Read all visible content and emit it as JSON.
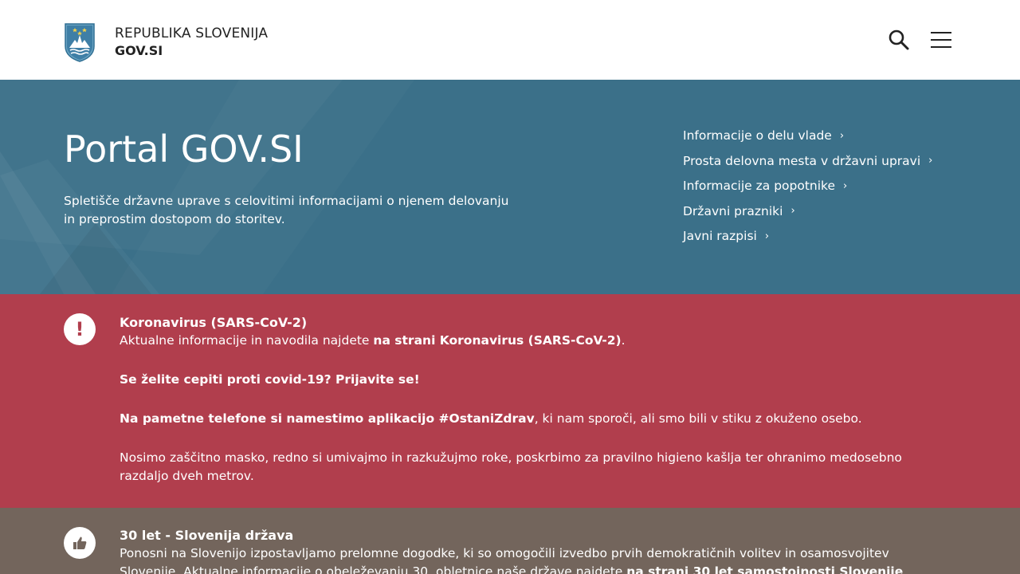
{
  "header": {
    "logo_line1": "REPUBLIKA SLOVENIJA",
    "logo_line2": "GOV.SI",
    "search_icon": "search-icon",
    "menu_icon": "hamburger-menu-icon"
  },
  "hero": {
    "title": "Portal GOV.SI",
    "description": "Spletišče državne uprave s celovitimi informacijami o njenem delovanju in preprostim dostopom do storitev.",
    "links": [
      {
        "label": "Informacije o delu vlade"
      },
      {
        "label": "Prosta delovna mesta v državni upravi"
      },
      {
        "label": "Informacije za popotnike"
      },
      {
        "label": "Državni prazniki"
      },
      {
        "label": "Javni razpisi"
      }
    ],
    "chevron": "›"
  },
  "notices": {
    "covid": {
      "icon": "!",
      "title": "Koronavirus (SARS-CoV-2)",
      "line1_prefix": "Aktualne informacije in navodila najdete ",
      "line1_link": "na strani Koronavirus (SARS-CoV-2)",
      "line1_suffix": ".",
      "vaccine": "Se želite cepiti proti covid-19? Prijavite se!",
      "app_bold": "Na pametne telefone si namestimo aplikacijo #OstaniZdrav",
      "app_rest": ", ki nam sporoči, ali smo bili v stiku z okuženo osebo.",
      "masks": "Nosimo zaščitno masko, redno si umivajmo in razkužujmo roke, poskrbimo za pravilno higieno kašlja ter ohranimo medosebno razdaljo dveh metrov."
    },
    "anniversary": {
      "title": "30 let - Slovenija država",
      "text_prefix": "Ponosni na Slovenijo izpostavljamo prelomne dogodke, ki so omogočili izvedbo prvih demokratičnih volitev in osamosvojitev Slovenije. Aktualne informacije o obeleževanju 30. obletnice naše države najdete ",
      "text_link": "na strani 30 let samostojnosti Slovenije",
      "text_suffix": "."
    }
  },
  "colors": {
    "hero_bg": "#3b7089",
    "notice_red": "#b13e4d",
    "notice_brown": "#73655c"
  }
}
